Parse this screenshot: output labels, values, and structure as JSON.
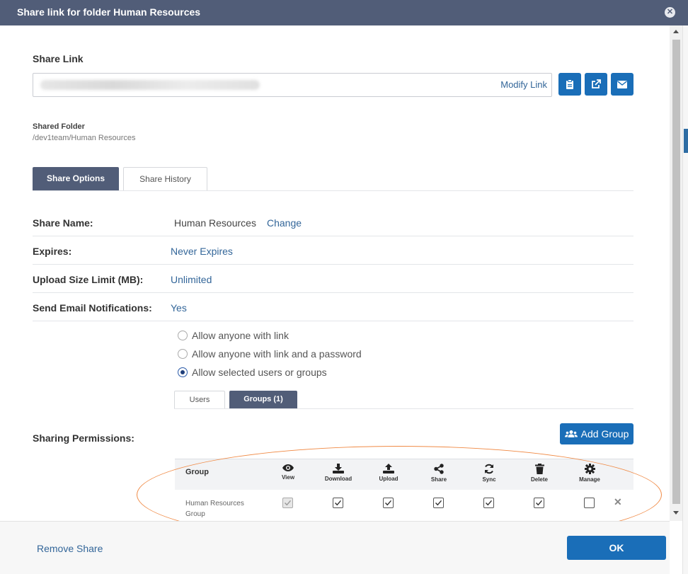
{
  "dialog": {
    "title": "Share link for folder Human Resources",
    "close_icon": "close-circle-icon"
  },
  "share_link": {
    "heading": "Share Link",
    "url_value": "https://dev1.codelathe.com/url/...",
    "modify_label": "Modify Link",
    "buttons": [
      {
        "name": "copy-link-button",
        "icon": "clipboard-icon"
      },
      {
        "name": "open-link-button",
        "icon": "external-link-icon"
      },
      {
        "name": "email-link-button",
        "icon": "envelope-icon"
      }
    ]
  },
  "shared_folder": {
    "label": "Shared Folder",
    "path": "/dev1team/Human Resources"
  },
  "tabs": [
    {
      "label": "Share Options",
      "active": true
    },
    {
      "label": "Share History",
      "active": false
    }
  ],
  "options": {
    "share_name_label": "Share Name:",
    "share_name_value": "Human Resources",
    "share_name_change": "Change",
    "expires_label": "Expires:",
    "expires_value": "Never Expires",
    "upload_limit_label": "Upload Size Limit (MB):",
    "upload_limit_value": "Unlimited",
    "email_notif_label": "Send Email Notifications:",
    "email_notif_value": "Yes"
  },
  "access": {
    "radios": [
      {
        "label": "Allow anyone with link",
        "selected": false
      },
      {
        "label": "Allow anyone with link and a password",
        "selected": false
      },
      {
        "label": "Allow selected users or groups",
        "selected": true
      }
    ],
    "subtabs": [
      {
        "label": "Users",
        "active": false
      },
      {
        "label": "Groups (1)",
        "active": true
      }
    ]
  },
  "permissions": {
    "label": "Sharing Permissions:",
    "add_group_label": "Add Group",
    "group_header": "Group",
    "columns": [
      {
        "label": "View",
        "icon": "eye-icon"
      },
      {
        "label": "Download",
        "icon": "download-icon"
      },
      {
        "label": "Upload",
        "icon": "upload-icon"
      },
      {
        "label": "Share",
        "icon": "share-icon"
      },
      {
        "label": "Sync",
        "icon": "sync-icon"
      },
      {
        "label": "Delete",
        "icon": "trash-icon"
      },
      {
        "label": "Manage",
        "icon": "gear-icon"
      }
    ],
    "rows": [
      {
        "group": "Human Resources Group",
        "view": true,
        "view_disabled": true,
        "download": true,
        "upload": true,
        "share": true,
        "sync": true,
        "delete": true,
        "manage": false
      }
    ]
  },
  "footer": {
    "remove_share_label": "Remove Share",
    "ok_label": "OK"
  },
  "colors": {
    "titlebar": "#515d78",
    "primary_button": "#1a6eb8",
    "link": "#336699",
    "annotation_ellipse": "#f08a45"
  }
}
